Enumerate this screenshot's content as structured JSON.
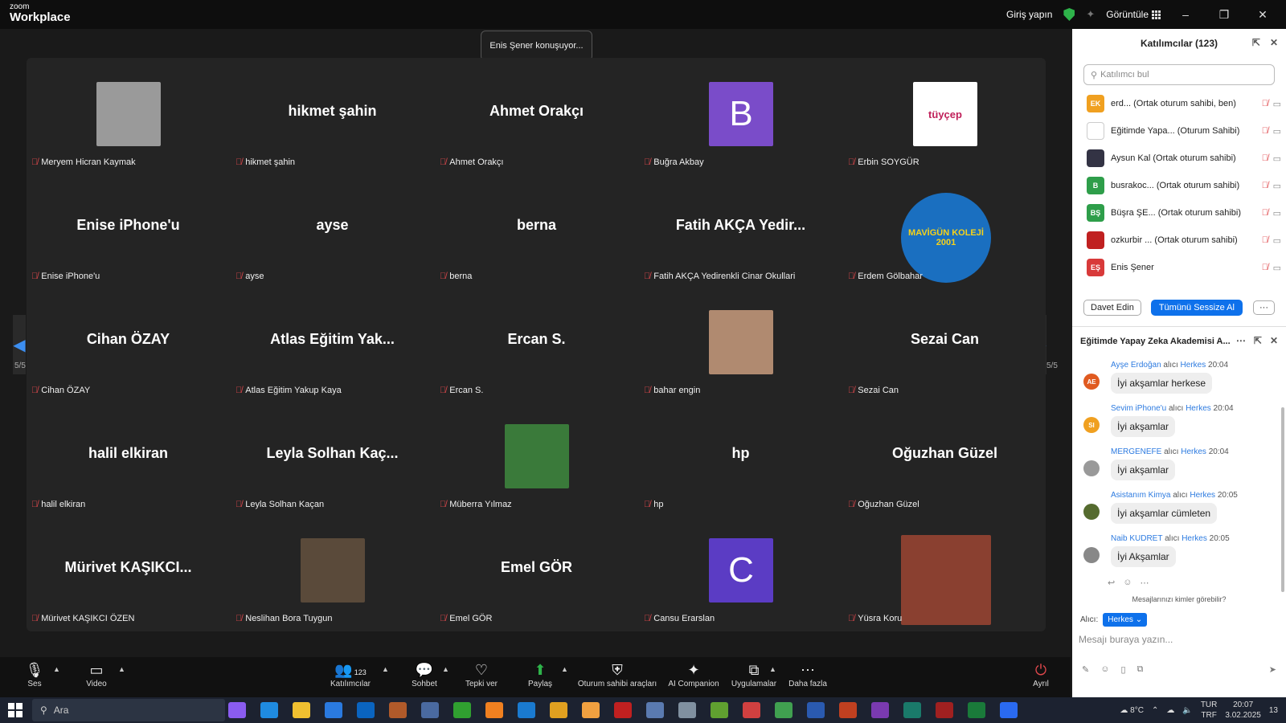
{
  "app": {
    "logo_top": "zoom",
    "logo_bottom": "Workplace",
    "signin": "Giriş yapın",
    "view_label": "Görüntüle"
  },
  "speaking": "Enis Şener konuşuyor...",
  "page_indicator": "5/5",
  "tiles": [
    {
      "big": "",
      "label": "Meryem Hicran Kaymak",
      "avatar": "photo-bird",
      "bg": "#9a9a9a"
    },
    {
      "big": "hikmet şahin",
      "label": "hikmet şahin",
      "avatar": ""
    },
    {
      "big": "Ahmet Orakçı",
      "label": "Ahmet Orakçı",
      "avatar": ""
    },
    {
      "big": "",
      "label": "Buğra Akbay",
      "avatar": "letter",
      "letter": "B",
      "bg": "#7a4cc9"
    },
    {
      "big": "",
      "label": "Erbin SOYGÜR",
      "avatar": "logo",
      "logo_text": "tüyçep",
      "bg": "#ffffff"
    },
    {
      "big": "Enise iPhone'u",
      "label": "Enise iPhone'u",
      "avatar": ""
    },
    {
      "big": "ayse",
      "label": "ayse",
      "avatar": ""
    },
    {
      "big": "berna",
      "label": "berna",
      "avatar": ""
    },
    {
      "big": "Fatih AKÇA Yedir...",
      "label": "Fatih AKÇA Yedirenkli Cinar Okullari",
      "avatar": ""
    },
    {
      "big": "",
      "label": "Erdem Gölbahar",
      "avatar": "logo-wide",
      "logo_text": "MAVİGÜN KOLEJİ 2001",
      "bg": "#1a6fc0"
    },
    {
      "big": "Cihan ÖZAY",
      "label": "Cihan ÖZAY",
      "avatar": ""
    },
    {
      "big": "Atlas Eğitim Yak...",
      "label": "Atlas Eğitim Yakup Kaya",
      "avatar": ""
    },
    {
      "big": "Ercan S.",
      "label": "Ercan S.",
      "avatar": ""
    },
    {
      "big": "",
      "label": "bahar engin",
      "avatar": "photo",
      "bg": "#b08a70"
    },
    {
      "big": "Sezai Can",
      "label": "Sezai Can",
      "avatar": ""
    },
    {
      "big": "halil elkiran",
      "label": "halil elkiran",
      "avatar": ""
    },
    {
      "big": "Leyla Solhan Kaç...",
      "label": "Leyla Solhan Kaçan",
      "avatar": ""
    },
    {
      "big": "",
      "label": "Müberra Yılmaz",
      "avatar": "photo",
      "bg": "#3a7a3a"
    },
    {
      "big": "hp",
      "label": "hp",
      "avatar": ""
    },
    {
      "big": "Oğuzhan Güzel",
      "label": "Oğuzhan Güzel",
      "avatar": ""
    },
    {
      "big": "Mürivet  KAŞIKCI...",
      "label": "Mürivet KAŞIKCI ÖZEN",
      "avatar": ""
    },
    {
      "big": "",
      "label": "Neslihan Bora Tuygun",
      "avatar": "photo",
      "bg": "#5a4a3a"
    },
    {
      "big": "Emel GÖR",
      "label": "Emel GÖR",
      "avatar": ""
    },
    {
      "big": "",
      "label": "Cansu Erarslan",
      "avatar": "letter",
      "letter": "C",
      "bg": "#5b3cc4"
    },
    {
      "big": "",
      "label": "Yüsra Koru",
      "avatar": "photo-wide",
      "bg": "#8a4030"
    }
  ],
  "toolbar": {
    "audio": "Ses",
    "video": "Video",
    "participants": "Katılımcılar",
    "participants_count": "123",
    "chat": "Sohbet",
    "react": "Tepki ver",
    "share": "Paylaş",
    "host_tools": "Oturum sahibi araçları",
    "ai": "AI Companion",
    "apps": "Uygulamalar",
    "more": "Daha fazla",
    "leave": "Ayrıl"
  },
  "participants_panel": {
    "title": "Katılımcılar (123)",
    "search_placeholder": "Katılımcı bul",
    "invite": "Davet Edin",
    "mute_all": "Tümünü Sessize Al",
    "more": "···",
    "rows": [
      {
        "initials": "EK",
        "name": "erd...  (Ortak oturum sahibi, ben)",
        "color": "#f0a020"
      },
      {
        "initials": "",
        "name": "Eğitimde Yapa...  (Oturum Sahibi)",
        "color": "#ffffff"
      },
      {
        "initials": "",
        "name": "Aysun Kal (Ortak oturum sahibi)",
        "color": "#333344"
      },
      {
        "initials": "B",
        "name": "busrakoc...  (Ortak oturum sahibi)",
        "color": "#2e9e4a"
      },
      {
        "initials": "BŞ",
        "name": "Büşra ŞE...  (Ortak oturum sahibi)",
        "color": "#2e9e4a"
      },
      {
        "initials": "",
        "name": "ozkurbir ...  (Ortak oturum sahibi)",
        "color": "#c02020"
      },
      {
        "initials": "EŞ",
        "name": "Enis Şener",
        "color": "#d83a3a"
      }
    ]
  },
  "chat_panel": {
    "title": "Eğitimde Yapay Zeka Akademisi A...",
    "who_can": "Mesajlarınızı kimler görebilir?",
    "to_label": "Alıcı:",
    "to_value": "Herkes",
    "placeholder": "Mesajı buraya yazın...",
    "messages": [
      {
        "initials": "AE",
        "from": "Ayşe Erdoğan",
        "to": "alıcı",
        "target": "Herkes",
        "time": "20:04",
        "text": "İyi akşamlar herkese",
        "color": "#e05a20"
      },
      {
        "initials": "SI",
        "from": "Sevim iPhone'u",
        "to": "alıcı",
        "target": "Herkes",
        "time": "20:04",
        "text": "İyi akşamlar",
        "color": "#f0a020"
      },
      {
        "initials": "",
        "from": "MERGENEFE",
        "to": "alıcı",
        "target": "Herkes",
        "time": "20:04",
        "text": "İyi akşamlar",
        "color": "#999999"
      },
      {
        "initials": "",
        "from": "Asistanım Kimya",
        "to": "alıcı",
        "target": "Herkes",
        "time": "20:05",
        "text": "İyi akşamlar cümleten",
        "color": "#556b2f"
      },
      {
        "initials": "",
        "from": "Naib KUDRET",
        "to": "alıcı",
        "target": "Herkes",
        "time": "20:05",
        "text": "İyi Akşamlar",
        "color": "#888888"
      }
    ]
  },
  "taskbar": {
    "search": "Ara",
    "temp": "8°C",
    "lang_top": "TUR",
    "lang_bottom": "TRF",
    "time": "20:07",
    "date": "3.02.2025",
    "notif": "13"
  }
}
